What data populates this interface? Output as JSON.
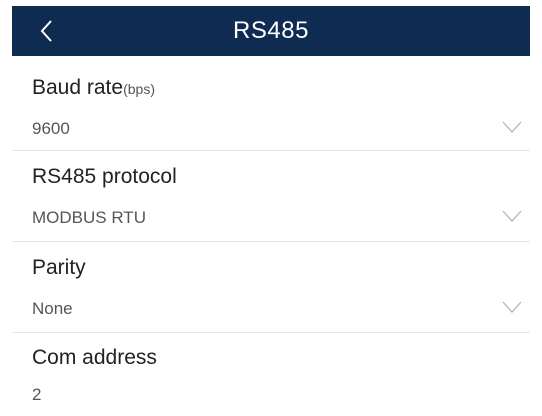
{
  "header": {
    "title": "RS485",
    "back_icon": "back-arrow-icon",
    "background": "#0f2b52"
  },
  "fields": [
    {
      "label": "Baud rate",
      "unit": "(bps)",
      "value": "9600",
      "dropdown": true,
      "icon": "chevron-down-icon"
    },
    {
      "label": "RS485 protocol",
      "value": "MODBUS RTU",
      "dropdown": true,
      "icon": "chevron-down-icon"
    },
    {
      "label": "Parity",
      "value": "None",
      "dropdown": true,
      "icon": "chevron-down-icon"
    },
    {
      "label": "Com address",
      "value": "2"
    }
  ]
}
